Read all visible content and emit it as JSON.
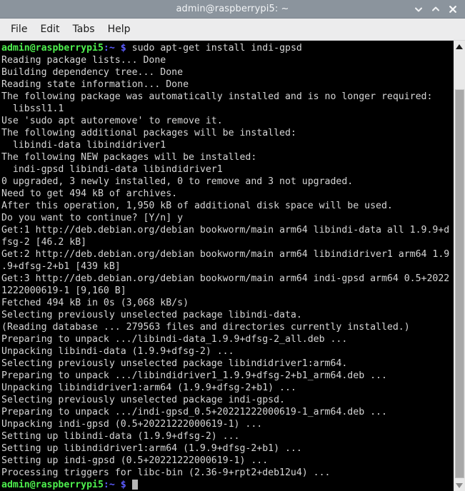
{
  "window": {
    "title": "admin@raspberrypi5: ~",
    "titlebar_color": "#8b949d",
    "buttons": [
      {
        "name": "minimize",
        "glyph": "chevron-down"
      },
      {
        "name": "maximize",
        "glyph": "chevron-up"
      },
      {
        "name": "close",
        "glyph": "x"
      }
    ]
  },
  "menubar": {
    "items": [
      {
        "label": "File"
      },
      {
        "label": "Edit"
      },
      {
        "label": "Tabs"
      },
      {
        "label": "Help"
      }
    ]
  },
  "terminal": {
    "background": "#000000",
    "foreground": "#d6d6d6",
    "prompt_user_color": "#4ef04e",
    "prompt_path_color": "#5c5cff",
    "prompt_user": "admin@raspberrypi5",
    "prompt_path": ":~",
    "prompt_symbol": "$",
    "command": "sudo apt-get install indi-gpsd",
    "lines": [
      {
        "type": "prompt",
        "command": "sudo apt-get install indi-gpsd"
      },
      {
        "type": "text",
        "text": "Reading package lists... Done"
      },
      {
        "type": "text",
        "text": "Building dependency tree... Done"
      },
      {
        "type": "text",
        "text": "Reading state information... Done"
      },
      {
        "type": "text",
        "text": "The following package was automatically installed and is no longer required:"
      },
      {
        "type": "text",
        "text": "  libssl1.1"
      },
      {
        "type": "text",
        "text": "Use 'sudo apt autoremove' to remove it."
      },
      {
        "type": "text",
        "text": "The following additional packages will be installed:"
      },
      {
        "type": "text",
        "text": "  libindi-data libindidriver1"
      },
      {
        "type": "text",
        "text": "The following NEW packages will be installed:"
      },
      {
        "type": "text",
        "text": "  indi-gpsd libindi-data libindidriver1"
      },
      {
        "type": "text",
        "text": "0 upgraded, 3 newly installed, 0 to remove and 3 not upgraded."
      },
      {
        "type": "text",
        "text": "Need to get 494 kB of archives."
      },
      {
        "type": "text",
        "text": "After this operation, 1,950 kB of additional disk space will be used."
      },
      {
        "type": "text",
        "text": "Do you want to continue? [Y/n] y"
      },
      {
        "type": "text",
        "text": "Get:1 http://deb.debian.org/debian bookworm/main arm64 libindi-data all 1.9.9+d"
      },
      {
        "type": "text",
        "text": "fsg-2 [46.2 kB]"
      },
      {
        "type": "text",
        "text": "Get:2 http://deb.debian.org/debian bookworm/main arm64 libindidriver1 arm64 1.9"
      },
      {
        "type": "text",
        "text": ".9+dfsg-2+b1 [439 kB]"
      },
      {
        "type": "text",
        "text": "Get:3 http://deb.debian.org/debian bookworm/main arm64 indi-gpsd arm64 0.5+2022"
      },
      {
        "type": "text",
        "text": "1222000619-1 [9,160 B]"
      },
      {
        "type": "text",
        "text": "Fetched 494 kB in 0s (3,068 kB/s)"
      },
      {
        "type": "text",
        "text": "Selecting previously unselected package libindi-data."
      },
      {
        "type": "text",
        "text": "(Reading database ... 279563 files and directories currently installed.)"
      },
      {
        "type": "text",
        "text": "Preparing to unpack .../libindi-data_1.9.9+dfsg-2_all.deb ..."
      },
      {
        "type": "text",
        "text": "Unpacking libindi-data (1.9.9+dfsg-2) ..."
      },
      {
        "type": "text",
        "text": "Selecting previously unselected package libindidriver1:arm64."
      },
      {
        "type": "text",
        "text": "Preparing to unpack .../libindidriver1_1.9.9+dfsg-2+b1_arm64.deb ..."
      },
      {
        "type": "text",
        "text": "Unpacking libindidriver1:arm64 (1.9.9+dfsg-2+b1) ..."
      },
      {
        "type": "text",
        "text": "Selecting previously unselected package indi-gpsd."
      },
      {
        "type": "text",
        "text": "Preparing to unpack .../indi-gpsd_0.5+20221222000619-1_arm64.deb ..."
      },
      {
        "type": "text",
        "text": "Unpacking indi-gpsd (0.5+20221222000619-1) ..."
      },
      {
        "type": "text",
        "text": "Setting up libindi-data (1.9.9+dfsg-2) ..."
      },
      {
        "type": "text",
        "text": "Setting up libindidriver1:arm64 (1.9.9+dfsg-2+b1) ..."
      },
      {
        "type": "text",
        "text": "Setting up indi-gpsd (0.5+20221222000619-1) ..."
      },
      {
        "type": "text",
        "text": "Processing triggers for libc-bin (2.36-9+rpt2+deb12u4) ..."
      },
      {
        "type": "prompt_cursor",
        "command": ""
      }
    ]
  },
  "scrollbar": {
    "up_arrow": "scroll-up",
    "down_arrow": "scroll-down"
  }
}
